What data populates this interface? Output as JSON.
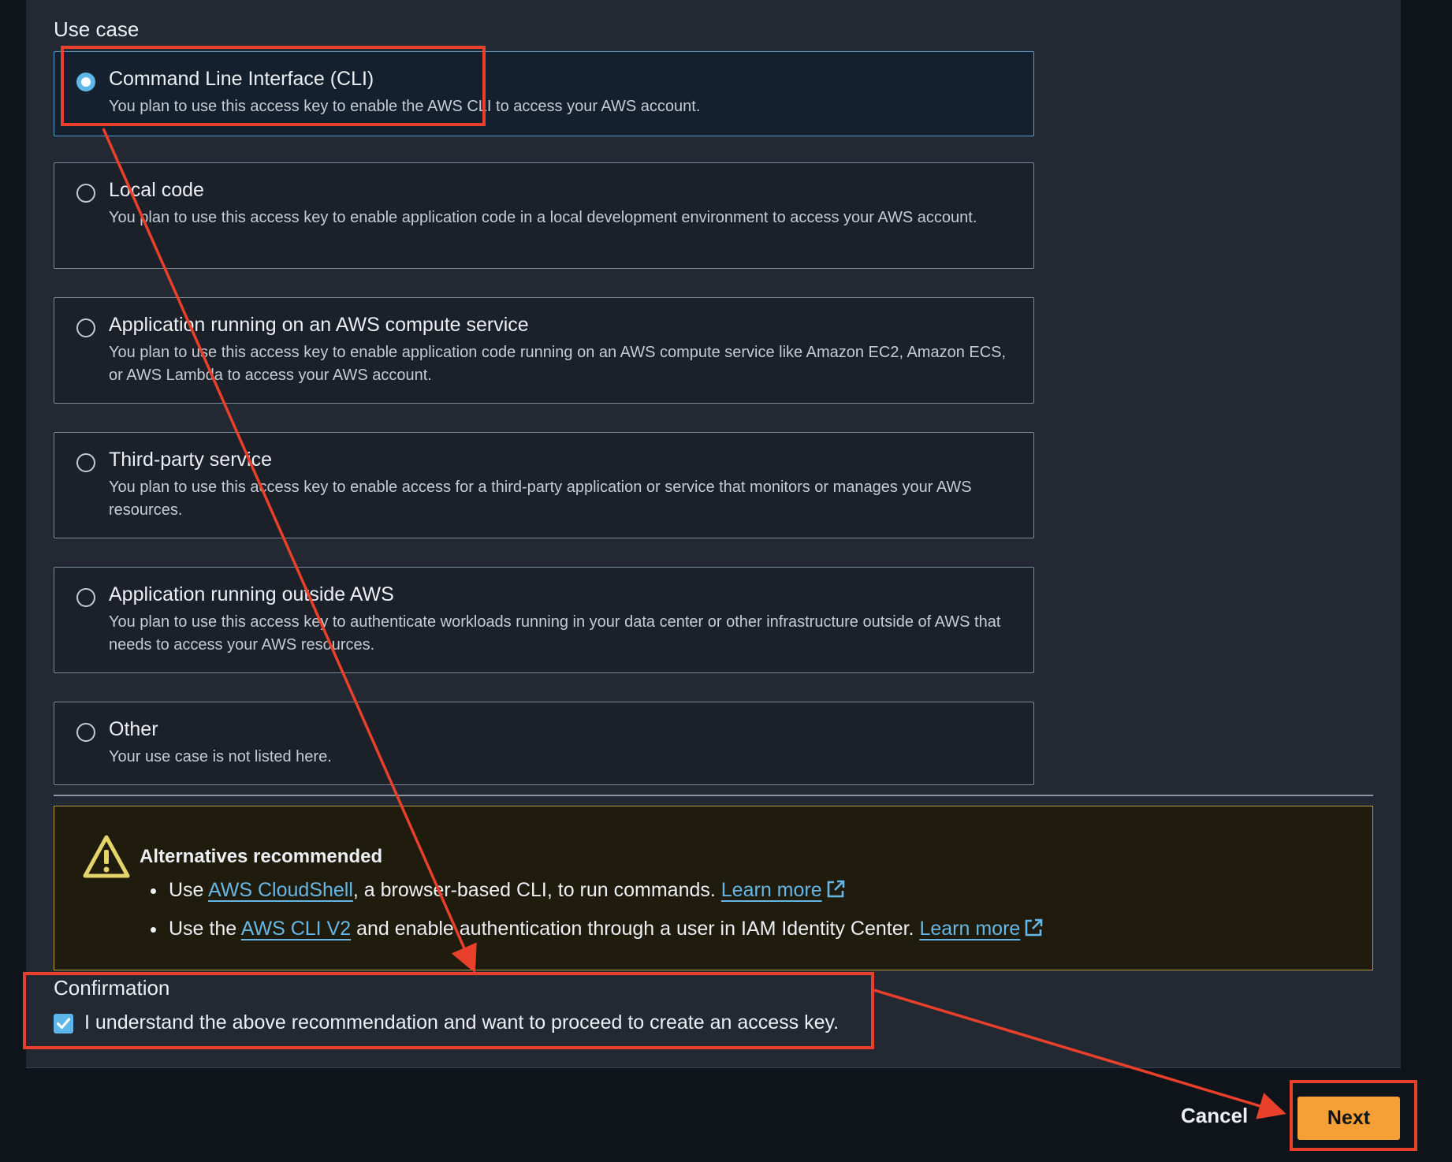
{
  "use_case": {
    "section_title": "Use case",
    "options": [
      {
        "title": "Command Line Interface (CLI)",
        "description": "You plan to use this access key to enable the AWS CLI to access your AWS account.",
        "selected": true
      },
      {
        "title": "Local code",
        "description": "You plan to use this access key to enable application code in a local development environment to access your AWS account.",
        "selected": false
      },
      {
        "title": "Application running on an AWS compute service",
        "description": "You plan to use this access key to enable application code running on an AWS compute service like Amazon EC2, Amazon ECS, or AWS Lambda to access your AWS account.",
        "selected": false
      },
      {
        "title": "Third-party service",
        "description": "You plan to use this access key to enable access for a third-party application or service that monitors or manages your AWS resources.",
        "selected": false
      },
      {
        "title": "Application running outside AWS",
        "description": "You plan to use this access key to authenticate workloads running in your data center or other infrastructure outside of AWS that needs to access your AWS resources.",
        "selected": false
      },
      {
        "title": "Other",
        "description": "Your use case is not listed here.",
        "selected": false
      }
    ]
  },
  "alert": {
    "title": "Alternatives recommended",
    "icon": "warning-icon",
    "items": [
      {
        "prefix": "Use ",
        "link_text": "AWS CloudShell",
        "suffix": ", a browser-based CLI, to run commands. ",
        "learn_more": "Learn more"
      },
      {
        "prefix": "Use the ",
        "link_text": "AWS CLI V2",
        "suffix": " and enable authentication through a user in IAM Identity Center. ",
        "learn_more": "Learn more"
      }
    ]
  },
  "confirmation": {
    "title": "Confirmation",
    "checkbox_label": "I understand the above recommendation and want to proceed to create an access key.",
    "checked": true
  },
  "actions": {
    "cancel_label": "Cancel",
    "next_label": "Next"
  },
  "colors": {
    "panel_background": "#232932",
    "accent_blue": "#5eb7ea",
    "link_blue": "#67b7e6",
    "primary_button": "#f4a034",
    "warning_yellow": "#e5d46a",
    "annotation_red": "#e8402b"
  }
}
